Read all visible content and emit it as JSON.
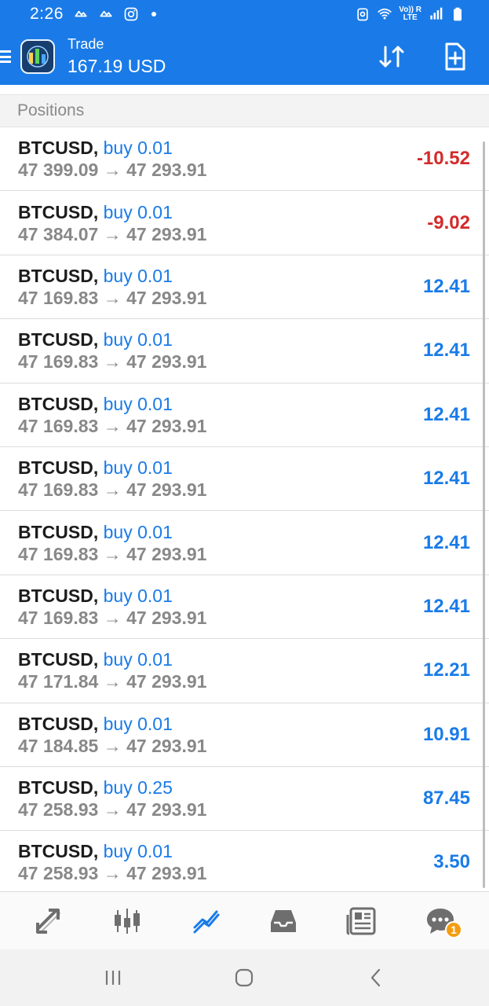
{
  "status_bar": {
    "time": "2:26",
    "icons": [
      "cloud-icon",
      "cloud-icon",
      "instagram-icon",
      "dot"
    ],
    "right_icons": [
      "alarm-icon",
      "wifi-icon",
      "volte-lte-icon",
      "signal-icon",
      "battery-icon"
    ],
    "lte_top": "Vo)) R",
    "lte_bottom": "LTE"
  },
  "app_bar": {
    "title": "Trade",
    "balance": "167.19 USD",
    "actions": [
      "sort-icon",
      "new-order-icon"
    ]
  },
  "section": {
    "title": "Positions"
  },
  "positions": [
    {
      "symbol": "BTCUSD",
      "side": "buy 0.01",
      "open": "47 399.09",
      "current": "47 293.91",
      "profit": "-10.52",
      "direction": "neg"
    },
    {
      "symbol": "BTCUSD",
      "side": "buy 0.01",
      "open": "47 384.07",
      "current": "47 293.91",
      "profit": "-9.02",
      "direction": "neg"
    },
    {
      "symbol": "BTCUSD",
      "side": "buy 0.01",
      "open": "47 169.83",
      "current": "47 293.91",
      "profit": "12.41",
      "direction": "pos"
    },
    {
      "symbol": "BTCUSD",
      "side": "buy 0.01",
      "open": "47 169.83",
      "current": "47 293.91",
      "profit": "12.41",
      "direction": "pos"
    },
    {
      "symbol": "BTCUSD",
      "side": "buy 0.01",
      "open": "47 169.83",
      "current": "47 293.91",
      "profit": "12.41",
      "direction": "pos"
    },
    {
      "symbol": "BTCUSD",
      "side": "buy 0.01",
      "open": "47 169.83",
      "current": "47 293.91",
      "profit": "12.41",
      "direction": "pos"
    },
    {
      "symbol": "BTCUSD",
      "side": "buy 0.01",
      "open": "47 169.83",
      "current": "47 293.91",
      "profit": "12.41",
      "direction": "pos"
    },
    {
      "symbol": "BTCUSD",
      "side": "buy 0.01",
      "open": "47 169.83",
      "current": "47 293.91",
      "profit": "12.41",
      "direction": "pos"
    },
    {
      "symbol": "BTCUSD",
      "side": "buy 0.01",
      "open": "47 171.84",
      "current": "47 293.91",
      "profit": "12.21",
      "direction": "pos"
    },
    {
      "symbol": "BTCUSD",
      "side": "buy 0.01",
      "open": "47 184.85",
      "current": "47 293.91",
      "profit": "10.91",
      "direction": "pos"
    },
    {
      "symbol": "BTCUSD",
      "side": "buy 0.25",
      "open": "47 258.93",
      "current": "47 293.91",
      "profit": "87.45",
      "direction": "pos"
    },
    {
      "symbol": "BTCUSD",
      "side": "buy 0.01",
      "open": "47 258.93",
      "current": "47 293.91",
      "profit": "3.50",
      "direction": "pos"
    }
  ],
  "bottom_nav": {
    "items": [
      "quotes-icon",
      "chart-icon",
      "trade-icon",
      "history-icon",
      "news-icon",
      "messages-icon"
    ],
    "active": "trade-icon",
    "messages_badge": "1"
  },
  "system_nav": [
    "recent-apps-icon",
    "home-icon",
    "back-icon"
  ],
  "colors": {
    "primary": "#1a7be8",
    "loss": "#d42a2a",
    "profit": "#1a7be8",
    "muted_text": "#888888",
    "badge": "#f39c12"
  }
}
